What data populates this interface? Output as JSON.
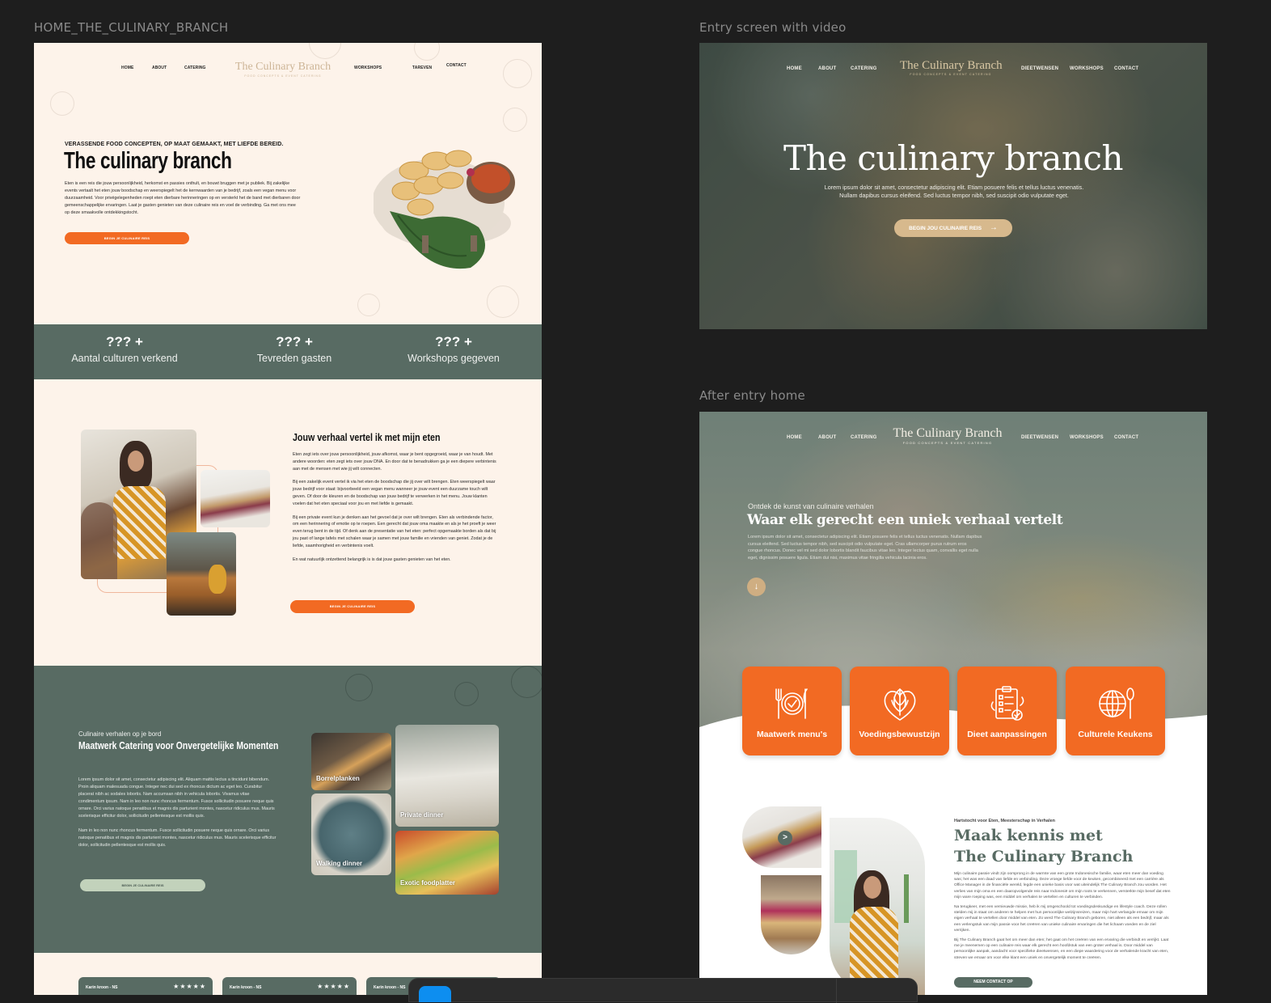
{
  "frames": {
    "home": {
      "label": "HOME_THE_CULINARY_BRANCH",
      "nav": {
        "left": [
          "HOME",
          "ABOUT",
          "CATERING"
        ],
        "right": [
          "WORKSHOPS",
          "TAREVEN",
          "CONTACT"
        ],
        "logo_title": "The Culinary Branch",
        "logo_subtitle": "FOOD CONCEPTS & EVENT CATERING"
      },
      "hero": {
        "kicker": "VERASSENDE FOOD CONCEPTEN, OP MAAT GEMAAKT, MET LIEFDE BEREID.",
        "title": "The culinary branch",
        "body": "Eten is een reis die jouw persoonlijkheid, herkomst en passies onthult, en bouwt bruggen met je publiek. Bij zakelijke events vertaalt het eten jouw boodschap en weerspiegelt het de kernwaarden van je bedrijf, zoals een vegan menu voor duurzaamheid. Voor privégelegenheden roept eten dierbare herinneringen op en versterkt het de band met dierbaren door gemeenschappelijke ervaringen. Laat je gasten genieten van deze culinaire reis en voel de verbinding. Ga met ons mee op deze smaakvolle ontdekkingstocht.",
        "cta": "BEGIN JE CULINAIRE REIS"
      },
      "stats": [
        {
          "value": "??? +",
          "label": "Aantal culturen verkend"
        },
        {
          "value": "??? +",
          "label": "Tevreden gasten"
        },
        {
          "value": "??? +",
          "label": "Workshops gegeven"
        }
      ],
      "story": {
        "title": "Jouw verhaal vertel ik met mijn eten",
        "paragraphs": [
          "Eten zegt iets over jouw persoonlijkheid, jouw afkomst, waar je bent opgegroeid, waar je van houdt. Met andere woorden: eten zegt iets over jouw DNA. En door dat te benadrukken ga je een diepere verbintenis aan met de mensen met wie jij wilt connecten.",
          "Bij een zakelijk event vertel ik via het eten de boodschap die jij over wilt brengen. Eten weerspiegelt waar jouw bedrijf voor staat: bijvoorbeeld een vegan menu wanneer je jouw event een duurzame touch wilt geven.  Of door de kleuren en de boodschap van jouw bedrijf te verwerken in het menu. Jouw klanten  voelen dat het eten speciaal voor jou en met liefde is gemaakt.",
          "Bij een private event kun je  denken aan het gevoel dat je over wilt brengen. Eten als verbindende factor, om een herinnering of emotie op te roepen. Een gerecht dat jouw oma maakte en als je het proeft je weer even terug bent in de tijd. Of denk aan de presentatie van het eten: perfect opgemaakte borden als dat bij jou past of lange tafels met schalen waar je samen met jouw familie en vrienden van geniet. Zodat je de liefde, saamhorigheid en verbintenis voelt.",
          "En wat natuurlijk ontzettend belangrijk is is dat jouw gasten genieten van het eten."
        ],
        "cta": "BEGIN JE CULINAIRE REIS"
      },
      "catering": {
        "kicker": "Culinaire verhalen op je bord",
        "title": "Maatwerk Catering voor Onvergetelijke Momenten",
        "paragraphs": [
          "Lorem ipsum dolor sit amet, consectetur adipiscing elit. Aliquam mattis lectus a tincidunt bibendum. Proin aliquam malesuada congue. Integer nec dui sed ex rhoncus dictum ac eget leo. Curabitur placerat nibh ac sodales lobortis. Nam accumsan nibh in vehicula lobortis. Vivamus vitae condimentum ipsum. Nam in leo non nunc rhoncus fermentum. Fusce sollicitudin posuere neque quis ornare. Orci varius natoque penatibus et magnis dis parturient montes, nascetur ridiculus mus. Mauris scelerisque efficitur dolor, sollicitudin pellentesque est mollis quis.",
          "Nam in leo non nunc rhoncus fermentum. Fusce sollicitudin posuere neque quis ornare. Orci varius natoque penatibus et magnis dis parturient montes, nascetur ridiculus mus. Mauris scelerisque efficitur dolor, sollicitudin pellentesque est mollis quis."
        ],
        "cta": "BEGIN JE CULINAIRE REIS",
        "tiles": [
          "Borrelplanken",
          "Private dinner",
          "Walking dinner",
          "Exotic foodplatter"
        ]
      },
      "reviews": [
        {
          "name": "Karin kroon - NS",
          "stars": "★★★★★"
        },
        {
          "name": "Karin kroon - NS",
          "stars": "★★★★★"
        },
        {
          "name": "Karin kroon - NS",
          "stars": ""
        }
      ]
    },
    "entry": {
      "label": "Entry screen with video",
      "nav": {
        "left": [
          "HOME",
          "ABOUT",
          "CATERING"
        ],
        "right": [
          "DIEETWENSEN",
          "WORKSHOPS",
          "CONTACT"
        ],
        "logo_title": "The Culinary Branch",
        "logo_subtitle": "FOOD CONCEPTS & EVENT CATERING"
      },
      "title": "The culinary branch",
      "body": "Lorem ipsum dolor sit amet, consectetur adipiscing elit. Etiam posuere felis et tellus luctus venenatis. Nullam dapibus cursus eleifend. Sed luctus tempor nibh, sed suscipit odio vulputate eget.",
      "cta": "BEGIN JOU CULINAIRE REIS",
      "cta_icon": "→"
    },
    "after": {
      "label": "After entry home",
      "nav": {
        "left": [
          "HOME",
          "ABOUT",
          "CATERING"
        ],
        "right": [
          "DIEETWENSEN",
          "WORKSHOPS",
          "CONTACT"
        ],
        "logo_title": "The Culinary Branch",
        "logo_subtitle": "FOOD CONCEPTS & EVENT CATERING"
      },
      "kicker": "Ontdek de kunst van culinaire verhalen",
      "title": "Waar elk gerecht een uniek verhaal vertelt",
      "body": "Lorem ipsum dolor sit amet, consectetur adipiscing elit. Etiam posuere felis et tellus luctus venenatis. Nullam dapibus cursus eleifend. Sed luctus tempor nibh, sed suscipit odio vulputate eget. Cras ullamcorper purus rutrum eros congue rhoncus. Donec vel mi sed dolor lobortis blandit faucibus vitae leo. Integer lectus quam, convallis eget nulla eget, dignissim posuere ligula. Etiam dui nisi, maximus vitae fringilla vehicula lacinia eros.",
      "scroll_icon": "↓",
      "services": [
        {
          "label": "Maatwerk menu's",
          "icon": "plate-cutlery-icon"
        },
        {
          "label": "Voedingsbewustzijn",
          "icon": "heart-leaf-icon"
        },
        {
          "label": "Dieet aanpassingen",
          "icon": "clipboard-check-icon"
        },
        {
          "label": "Culturele Keukens",
          "icon": "globe-spoon-icon"
        }
      ],
      "about": {
        "kicker": "Hartstocht voor Eten, Meesterschap in Verhalen",
        "title_line1": "Maak kennis met",
        "title_line2": "The Culinary Branch",
        "paragraphs": [
          "Mijn culinaire passie vindt zijn oorsprong in de warmte van een grote Indonesische familie, waar eten meer dan voeding was; het was een daad van liefde en verbinding. Deze vroege liefde voor de keuken, gecombineerd met een carrière als Office Manager in de financiële wereld, legde een unieke basis voor wat uiteindelijk The Culinary Branch zou worden. Het verlies van mijn oma en een daaropvolgende reis naar Indonesië om mijn roots te verkennen, versterkte mijn besef dat eten mijn ware roeping was, een middel om verhalen te vertellen en culturen te verbinden.",
          "Na terugkeer, met een vernieuwde missie, heb ik mij omgeschoold tot voedingsdeskundige en lifestyle coach. Deze rollen stelden mij in staat om anderen te helpen met hun persoonlijke welzijnsreizen, maar mijn hart verlangde ernaar om mijn eigen verhaal te vertellen door middel van eten. Zo werd The Culinary Branch geboren, niet alleen als een bedrijf, maar als een verlengstuk van mijn passie voor het creëren van unieke culinaire ervaringen die het lichaam voeden en de ziel verrijken.",
          "Bij The Culinary Branch gaat het om meer dan eten; het gaat om het creëren van een ervaring die verbindt en verrijkt. Laat me je meenemen op een culinaire reis waar elk gerecht een hoofdstuk van een groter verhaal is. Door middel van persoonlijke aanpak, aandacht voor specifieke dieetwensen, en een diepe waardering voor de verhalende kracht van eten, streven we ernaar om voor elke klant een uniek en onvergetelijk moment te creëren."
        ],
        "cta": "NEEM CONTACT OP",
        "carousel_icon": ">"
      }
    }
  },
  "colors": {
    "cream": "#fdf3ea",
    "sage_green": "#586b63",
    "orange": "#f26a23",
    "tan": "#d7b98d",
    "canvas": "#1e1e1e"
  }
}
